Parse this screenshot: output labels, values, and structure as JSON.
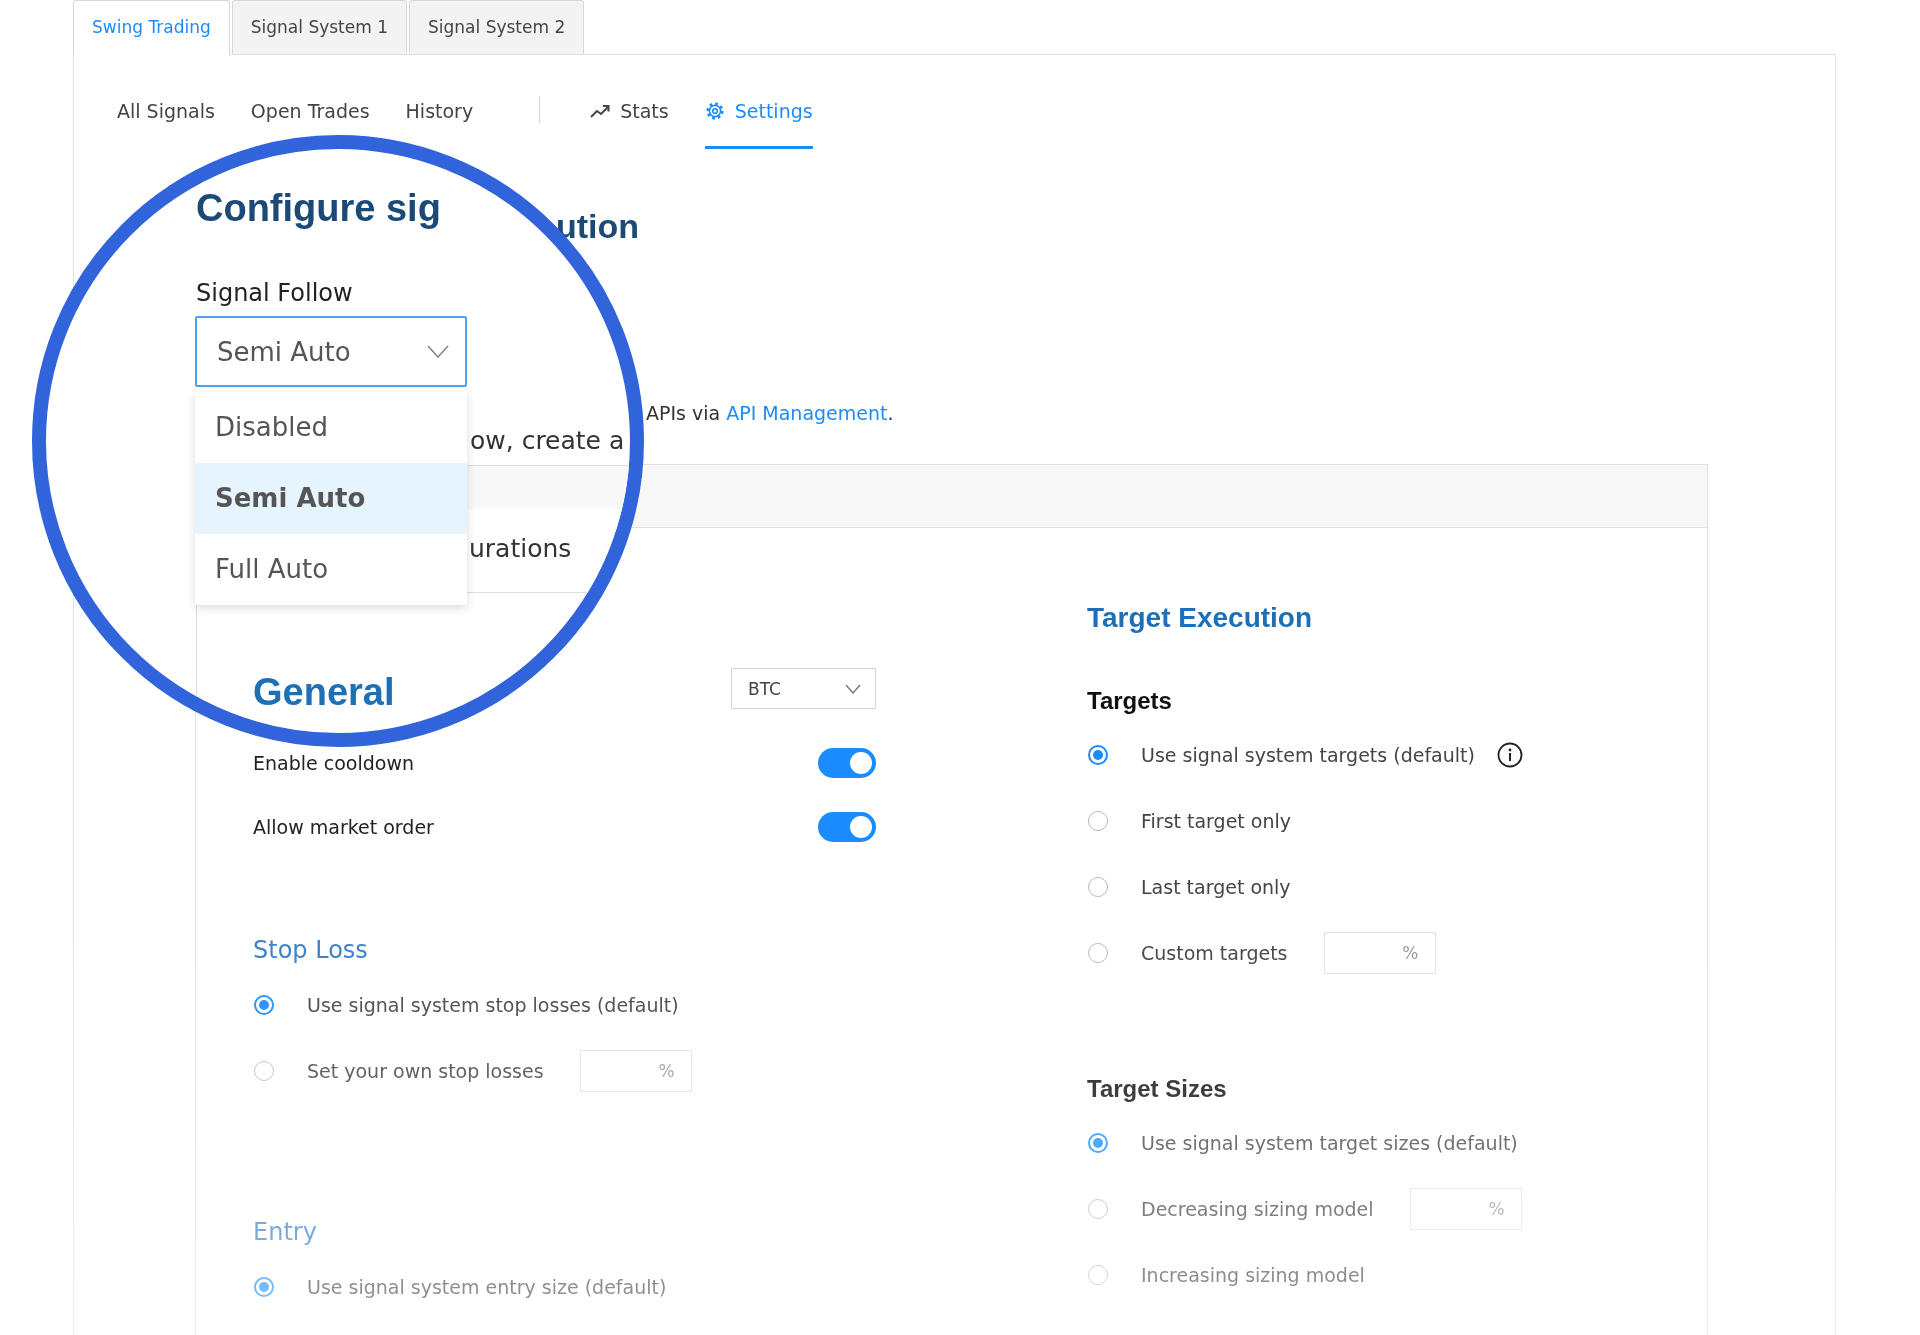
{
  "top_tabs": [
    {
      "label": "Swing Trading",
      "selected": true
    },
    {
      "label": "Signal System 1",
      "selected": false
    },
    {
      "label": "Signal System 2",
      "selected": false
    }
  ],
  "nav_left": [
    {
      "label": "All Signals",
      "selected": false
    },
    {
      "label": "Open Trades",
      "selected": false
    },
    {
      "label": "History",
      "selected": false
    }
  ],
  "nav_right": [
    {
      "label": "Stats",
      "selected": false
    },
    {
      "label": "Settings",
      "selected": true
    }
  ],
  "title_fragment": "ution",
  "api_note": {
    "before": "APIs via ",
    "link": "API Management",
    "after": "."
  },
  "left": {
    "currency_select": "BTC",
    "toggles": [
      {
        "label": "Enable cooldown",
        "on": true
      },
      {
        "label": "Allow market order",
        "on": true
      }
    ],
    "stop_loss": {
      "title": "Stop Loss",
      "options": [
        {
          "label": "Use signal system stop losses (default)",
          "selected": true
        },
        {
          "label": "Set your own stop losses",
          "selected": false,
          "placeholder": "%"
        }
      ]
    },
    "entry": {
      "title": "Entry",
      "options": [
        {
          "label": "Use signal system entry size (default)",
          "selected": true
        }
      ]
    }
  },
  "right": {
    "title": "Target Execution",
    "targets": {
      "title": "Targets",
      "options": [
        {
          "label": "Use signal system targets (default)",
          "selected": true,
          "info": true
        },
        {
          "label": "First target only",
          "selected": false
        },
        {
          "label": "Last target only",
          "selected": false
        },
        {
          "label": "Custom targets",
          "selected": false,
          "placeholder": "%"
        }
      ]
    },
    "target_sizes": {
      "title": "Target Sizes",
      "options": [
        {
          "label": "Use signal system target sizes (default)",
          "selected": true
        },
        {
          "label": "Decreasing sizing model",
          "selected": false,
          "placeholder": "%"
        },
        {
          "label": "Increasing sizing model",
          "selected": false
        }
      ]
    }
  },
  "magnifier": {
    "title": "Configure sig",
    "field_label": "Signal Follow",
    "select_value": "Semi Auto",
    "options": [
      {
        "label": "Disabled",
        "selected": false
      },
      {
        "label": "Semi Auto",
        "selected": true
      },
      {
        "label": "Full Auto",
        "selected": false
      }
    ],
    "sentence_fragment": "ow, create a",
    "tab_fragment": "urations",
    "section_title": "General"
  }
}
